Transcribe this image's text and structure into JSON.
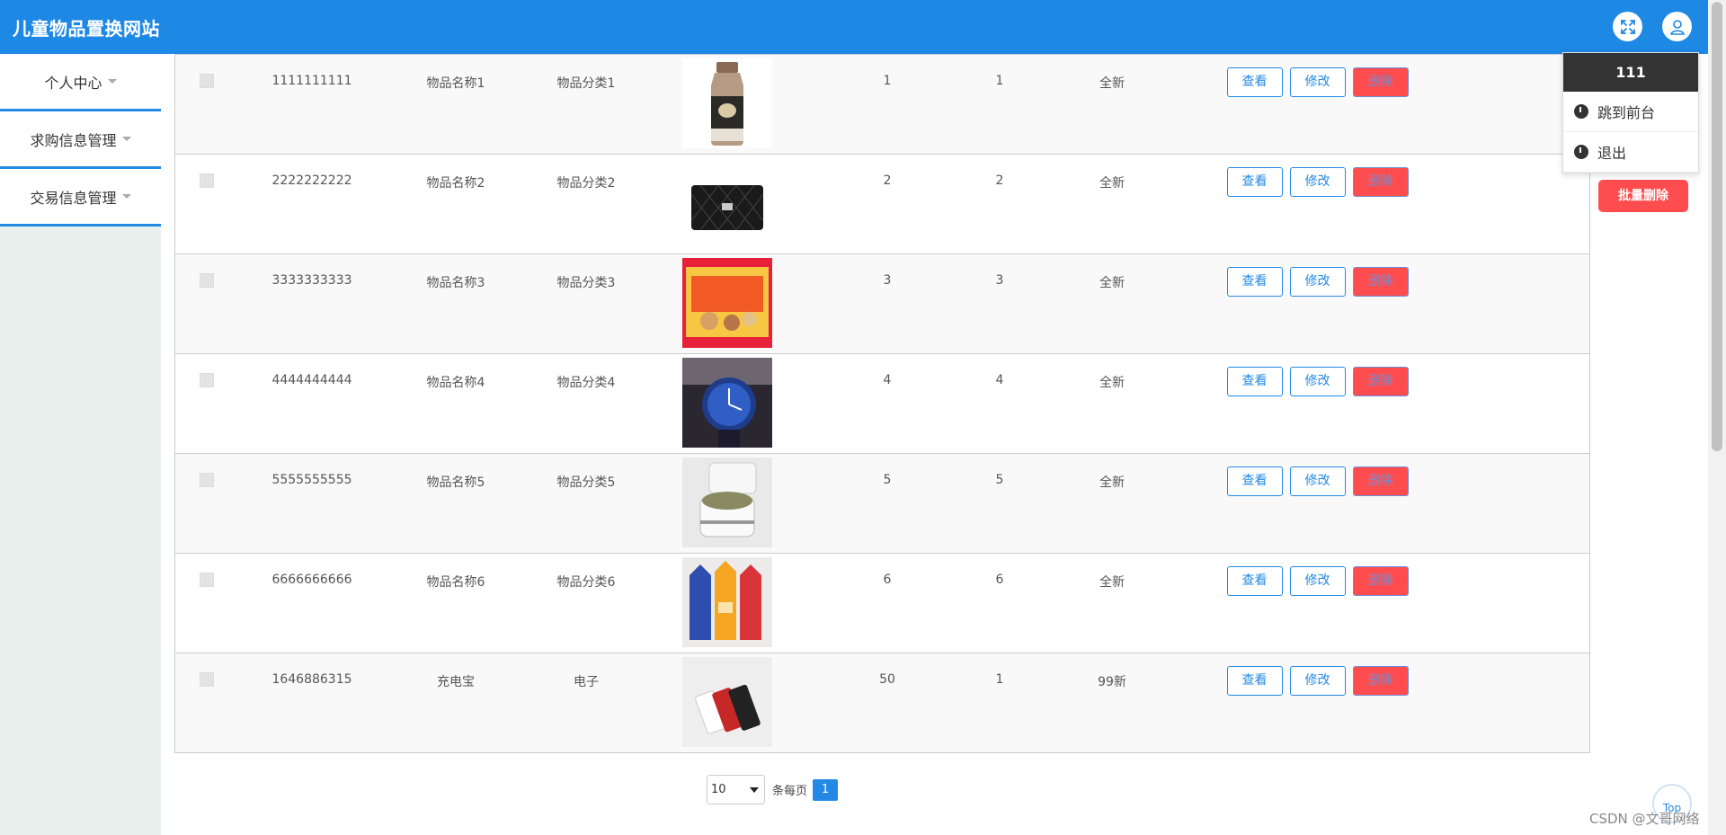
{
  "app": {
    "title": "儿童物品置换网站"
  },
  "header": {
    "fullscreen_icon": "expand-icon",
    "user_icon": "user-icon"
  },
  "sidebar": {
    "items": [
      {
        "label": "个人中心"
      },
      {
        "label": "求购信息管理"
      },
      {
        "label": "交易信息管理"
      }
    ]
  },
  "user_menu": {
    "username": "111",
    "items": [
      {
        "label": "跳到前台",
        "icon": "power-icon"
      },
      {
        "label": "退出",
        "icon": "power-icon"
      }
    ]
  },
  "actions": {
    "batch_delete": "批量删除"
  },
  "table": {
    "buttons": {
      "view": "查看",
      "edit": "修改",
      "delete": "删除"
    },
    "rows": [
      {
        "id": "1111111111",
        "name": "物品名称1",
        "category": "物品分类1",
        "image": "milk-bottle",
        "num1": "1",
        "num2": "1",
        "condition": "全新"
      },
      {
        "id": "2222222222",
        "name": "物品名称2",
        "category": "物品分类2",
        "image": "black-handbag",
        "num1": "2",
        "num2": "2",
        "condition": "全新"
      },
      {
        "id": "3333333333",
        "name": "物品名称3",
        "category": "物品分类3",
        "image": "snack-box",
        "num1": "3",
        "num2": "3",
        "condition": "全新"
      },
      {
        "id": "4444444444",
        "name": "物品名称4",
        "category": "物品分类4",
        "image": "wrist-watch",
        "num1": "4",
        "num2": "4",
        "condition": "全新"
      },
      {
        "id": "5555555555",
        "name": "物品名称5",
        "category": "物品分类5",
        "image": "cream-jar",
        "num1": "5",
        "num2": "5",
        "condition": "全新"
      },
      {
        "id": "6666666666",
        "name": "物品名称6",
        "category": "物品分类6",
        "image": "milk-cartons",
        "num1": "6",
        "num2": "6",
        "condition": "全新"
      },
      {
        "id": "1646886315",
        "name": "充电宝",
        "category": "电子",
        "image": "power-bank",
        "num1": "50",
        "num2": "1",
        "condition": "99新"
      }
    ]
  },
  "pagination": {
    "page_size": "10",
    "per_page_label": "条每页",
    "current_page": "1"
  },
  "top_button": "Top",
  "watermark": "CSDN @文哥网络"
}
